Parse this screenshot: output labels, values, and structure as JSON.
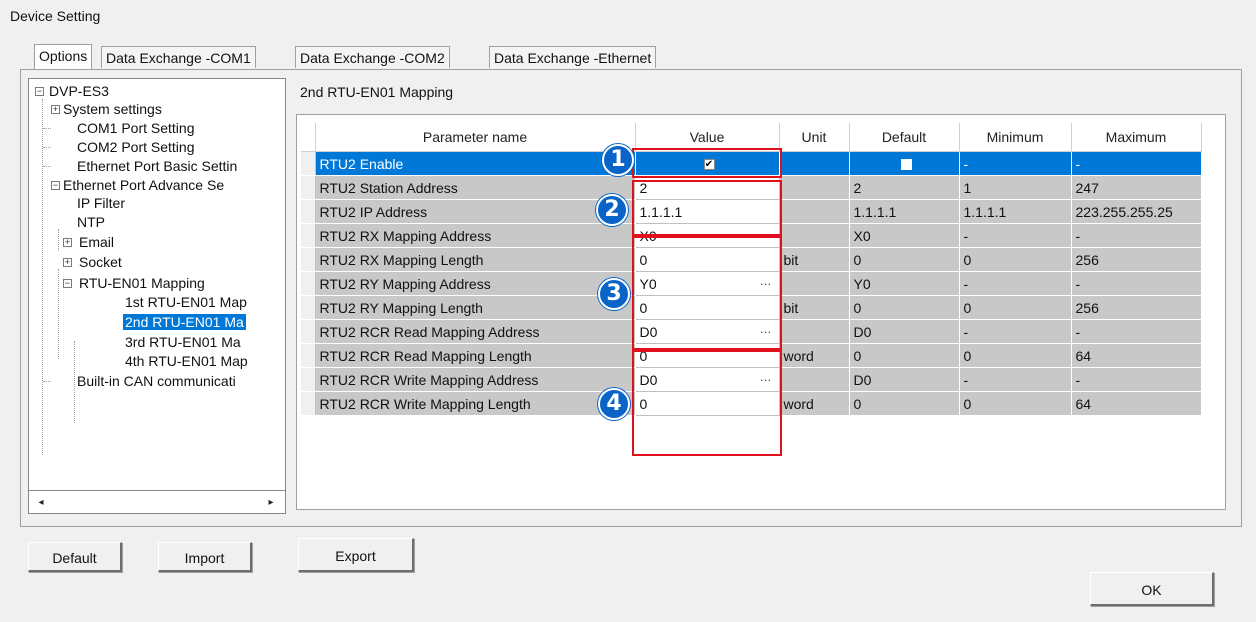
{
  "window": {
    "title": "Device Setting"
  },
  "tabs": [
    {
      "label": "Options"
    },
    {
      "label": "Data Exchange -COM1"
    },
    {
      "label": "Data Exchange -COM2"
    },
    {
      "label": "Data Exchange -Ethernet"
    }
  ],
  "tree": {
    "items": [
      {
        "label": "DVP-ES3",
        "expander": "−"
      },
      {
        "label": "System settings",
        "expander": "+"
      },
      {
        "label": "COM1 Port Setting"
      },
      {
        "label": "COM2 Port Setting"
      },
      {
        "label": "Ethernet Port Basic Settin"
      },
      {
        "label": "Ethernet Port Advance Se",
        "expander": "−"
      },
      {
        "label": "IP Filter"
      },
      {
        "label": "NTP"
      },
      {
        "label": "Email",
        "expander": "+"
      },
      {
        "label": "Socket",
        "expander": "+"
      },
      {
        "label": "RTU-EN01 Mapping",
        "expander": "−"
      },
      {
        "label": "1st RTU-EN01 Map"
      },
      {
        "label": "2nd RTU-EN01 Ma"
      },
      {
        "label": "3rd RTU-EN01 Ma"
      },
      {
        "label": "4th RTU-EN01 Map"
      },
      {
        "label": "Built-in CAN communicati"
      }
    ],
    "scroll_left": "◂",
    "scroll_right": "▸"
  },
  "panel": {
    "title": "2nd RTU-EN01 Mapping"
  },
  "grid": {
    "headers": {
      "name": "Parameter name",
      "value": "Value",
      "unit": "Unit",
      "default": "Default",
      "min": "Minimum",
      "max": "Maximum"
    },
    "rows": [
      {
        "name": "RTU2 Enable",
        "value": "✔",
        "unit": "",
        "default": "",
        "min": "-",
        "max": "-"
      },
      {
        "name": "RTU2 Station Address",
        "value": "2",
        "unit": "",
        "default": "2",
        "min": "1",
        "max": "247"
      },
      {
        "name": "RTU2 IP Address",
        "value": "1.1.1.1",
        "unit": "",
        "default": "1.1.1.1",
        "min": "1.1.1.1",
        "max": "223.255.255.25"
      },
      {
        "name": "RTU2 RX Mapping Address",
        "value": "X0",
        "unit": "",
        "default": "X0",
        "min": "-",
        "max": "-",
        "ellipsis": "…"
      },
      {
        "name": "RTU2 RX Mapping Length",
        "value": "0",
        "unit": "bit",
        "default": "0",
        "min": "0",
        "max": "256"
      },
      {
        "name": "RTU2 RY Mapping Address",
        "value": "Y0",
        "unit": "",
        "default": "Y0",
        "min": "-",
        "max": "-",
        "ellipsis": "…"
      },
      {
        "name": "RTU2 RY Mapping Length",
        "value": "0",
        "unit": "bit",
        "default": "0",
        "min": "0",
        "max": "256"
      },
      {
        "name": "RTU2 RCR Read Mapping Address",
        "value": "D0",
        "unit": "",
        "default": "D0",
        "min": "-",
        "max": "-",
        "ellipsis": "…"
      },
      {
        "name": "RTU2 RCR Read Mapping Length",
        "value": "0",
        "unit": "word",
        "default": "0",
        "min": "0",
        "max": "64"
      },
      {
        "name": "RTU2 RCR Write Mapping Address",
        "value": "D0",
        "unit": "",
        "default": "D0",
        "min": "-",
        "max": "-",
        "ellipsis": "…"
      },
      {
        "name": "RTU2 RCR Write Mapping Length",
        "value": "0",
        "unit": "word",
        "default": "0",
        "min": "0",
        "max": "64"
      }
    ]
  },
  "callouts": [
    "1",
    "2",
    "3",
    "4"
  ],
  "buttons": {
    "default": "Default",
    "import": "Import",
    "export": "Export",
    "ok": "OK"
  },
  "colors": {
    "selection": "#0078d7",
    "highlight_box": "#e0101c",
    "callout": "#0a64c8",
    "cell_gray": "#c8c8c8"
  }
}
